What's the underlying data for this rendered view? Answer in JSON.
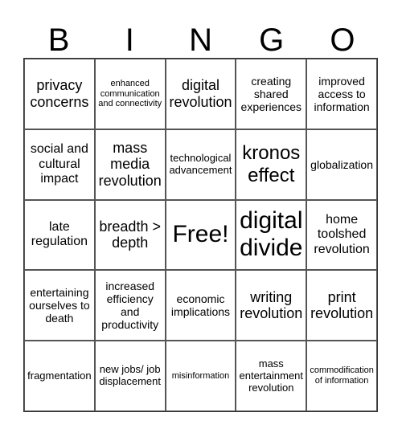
{
  "header": {
    "letters": [
      "B",
      "I",
      "N",
      "G",
      "O"
    ]
  },
  "cells": [
    "privacy concerns",
    "enhanced communication and connectivity",
    "digital revolution",
    "creating shared experiences",
    "improved access to information",
    "social and cultural impact",
    "mass media revolution",
    "technological advancement",
    "kronos effect",
    "globalization",
    "late regulation",
    "breadth > depth",
    "Free!",
    "digital divide",
    "home toolshed revolution",
    "entertaining ourselves to death",
    "increased efficiency and productivity",
    "economic implications",
    "writing revolution",
    "print revolution",
    "fragmentation",
    "new jobs/ job displacement",
    "misinformation",
    "mass entertainment revolution",
    "commodification of information"
  ]
}
